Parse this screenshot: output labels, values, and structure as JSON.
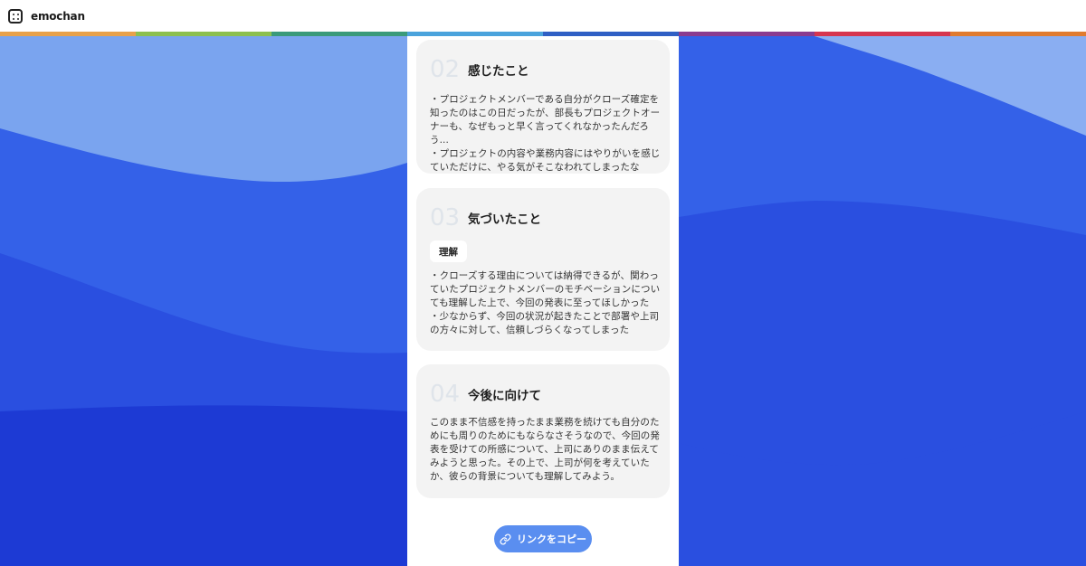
{
  "header": {
    "app_name": "emochan",
    "logo_icon": "smiley-face-icon"
  },
  "colors": {
    "bg_light": "#8aaef2",
    "bg_mid": "#3461e8",
    "bg_dark": "#2347dc",
    "card_bg": "#f3f3f3",
    "button_bg": "#5a8ef0",
    "rainbow": [
      "#e8a14a",
      "#8cc04f",
      "#3a9a7a",
      "#4aa3dc",
      "#2f5fc4",
      "#8a3b8f",
      "#d6354f",
      "#e07b2f"
    ]
  },
  "cards": [
    {
      "number": "02",
      "title": "感じたこと",
      "body": "・プロジェクトメンバーである自分がクローズ確定を知ったのはこの日だったが、部長もプロジェクトオーナーも、なぜもっと早く言ってくれなかったんだろう...\n・プロジェクトの内容や業務内容にはやりがいを感じていただけに、やる気がそこなわれてしまったな"
    },
    {
      "number": "03",
      "title": "気づいたこと",
      "tag": "理解",
      "body": "・クローズする理由については納得できるが、関わっていたプロジェクトメンバーのモチベーションについても理解した上で、今回の発表に至ってほしかった\n・少なからず、今回の状況が起きたことで部署や上司の方々に対して、信頼しづらくなってしまった"
    },
    {
      "number": "04",
      "title": "今後に向けて",
      "body": "このまま不信感を持ったまま業務を続けても自分のためにも周りのためにもならなさそうなので、今回の発表を受けての所感について、上司にありのまま伝えてみようと思った。その上で、上司が何を考えていたか、彼らの背景についても理解してみよう。"
    }
  ],
  "copy_button": {
    "label": "リンクをコピー",
    "icon": "link-icon"
  }
}
